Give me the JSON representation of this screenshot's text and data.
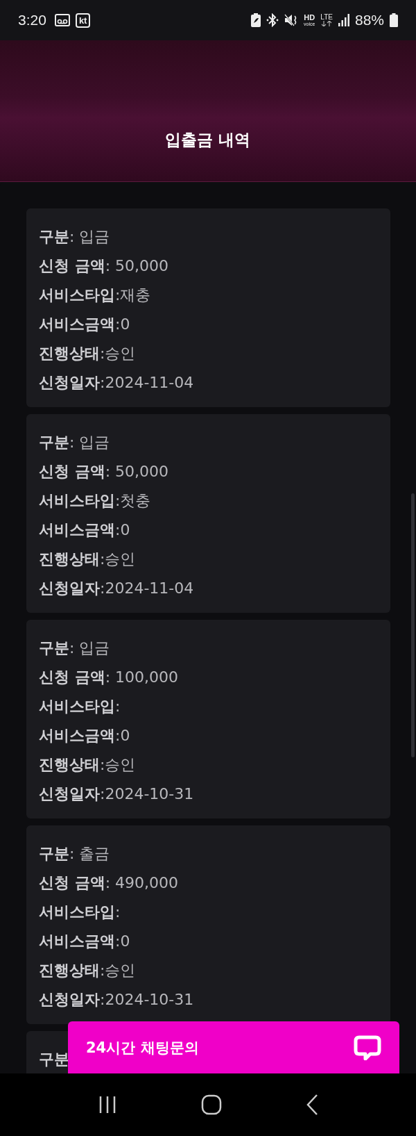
{
  "status_bar": {
    "time": "3:20",
    "carrier": "kt",
    "hd": "HD",
    "voice": "voice",
    "network": "LTE",
    "battery": "88%"
  },
  "header": {
    "title": "입출금 내역"
  },
  "records": [
    {
      "rows": [
        "**구분**: 입금",
        "**신청 금액**: 50,000",
        "**서비스타입**:재충",
        "**서비스금액**:0",
        "**진행상태**:승인",
        "**신청일자**:2024-11-04"
      ]
    },
    {
      "rows": [
        "**구분**: 입금",
        "**신청 금액**: 50,000",
        "**서비스타입**:첫충",
        "**서비스금액**:0",
        "**진행상태**:승인",
        "**신청일자**:2024-11-04"
      ]
    },
    {
      "rows": [
        "**구분**: 입금",
        "**신청 금액**: 100,000",
        "**서비스타입**:",
        "**서비스금액**:0",
        "**진행상태**:승인",
        "**신청일자**:2024-10-31"
      ]
    },
    {
      "rows": [
        "**구분**: 출금",
        "**신청 금액**: 490,000",
        "**서비스타입**:",
        "**서비스금액**:0",
        "**진행상태**:승인",
        "**신청일자**:2024-10-31"
      ]
    },
    {
      "rows": [
        "**구분**"
      ]
    }
  ],
  "chat_button": {
    "label": "24시간 채팅문의"
  }
}
